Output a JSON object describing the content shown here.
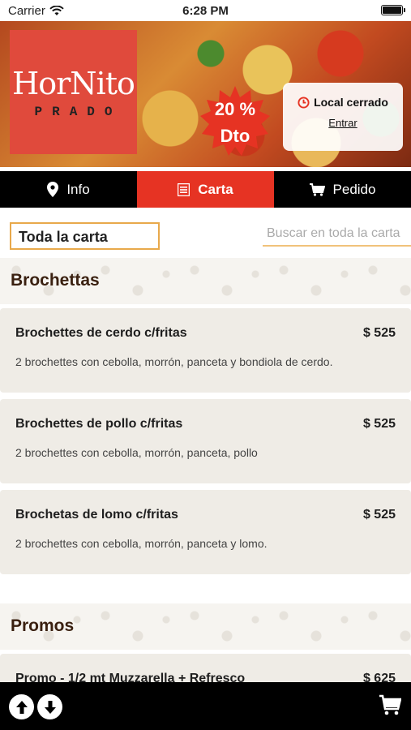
{
  "status_bar": {
    "carrier": "Carrier",
    "time": "6:28 PM"
  },
  "banner": {
    "logo_word": "HorNito",
    "logo_sub": "PRADO",
    "discount_line1": "20 %",
    "discount_line2": "Dto",
    "status_text": "Local cerrado",
    "enter_link": "Entrar"
  },
  "tabs": [
    {
      "label": "Info",
      "icon": "location-pin-icon",
      "active": false
    },
    {
      "label": "Carta",
      "icon": "menu-list-icon",
      "active": true
    },
    {
      "label": "Pedido",
      "icon": "cart-icon",
      "active": false
    }
  ],
  "filter": {
    "category_selected": "Toda la carta",
    "search_placeholder": "Buscar en toda la carta"
  },
  "sections": [
    {
      "title": "Brochettas",
      "items": [
        {
          "name": "Brochettes de cerdo c/fritas",
          "price": "$ 525",
          "description": "2 brochettes con cebolla, morrón, panceta y bondiola de cerdo."
        },
        {
          "name": "Brochettes de pollo c/fritas",
          "price": "$ 525",
          "description": "2 brochettes con cebolla, morrón, panceta, pollo"
        },
        {
          "name": "Brochetas de lomo c/fritas",
          "price": "$ 525",
          "description": "2 brochettes con cebolla, morrón, panceta y lomo."
        }
      ]
    },
    {
      "title": "Promos",
      "items": [
        {
          "name": "Promo - 1/2 mt Muzzarella + Refresco",
          "price": "$ 625",
          "description": ""
        }
      ]
    }
  ],
  "colors": {
    "accent": "#e63323",
    "nav_bg": "#000000",
    "card_bg": "#efece6",
    "border_accent": "#e8a94b"
  }
}
